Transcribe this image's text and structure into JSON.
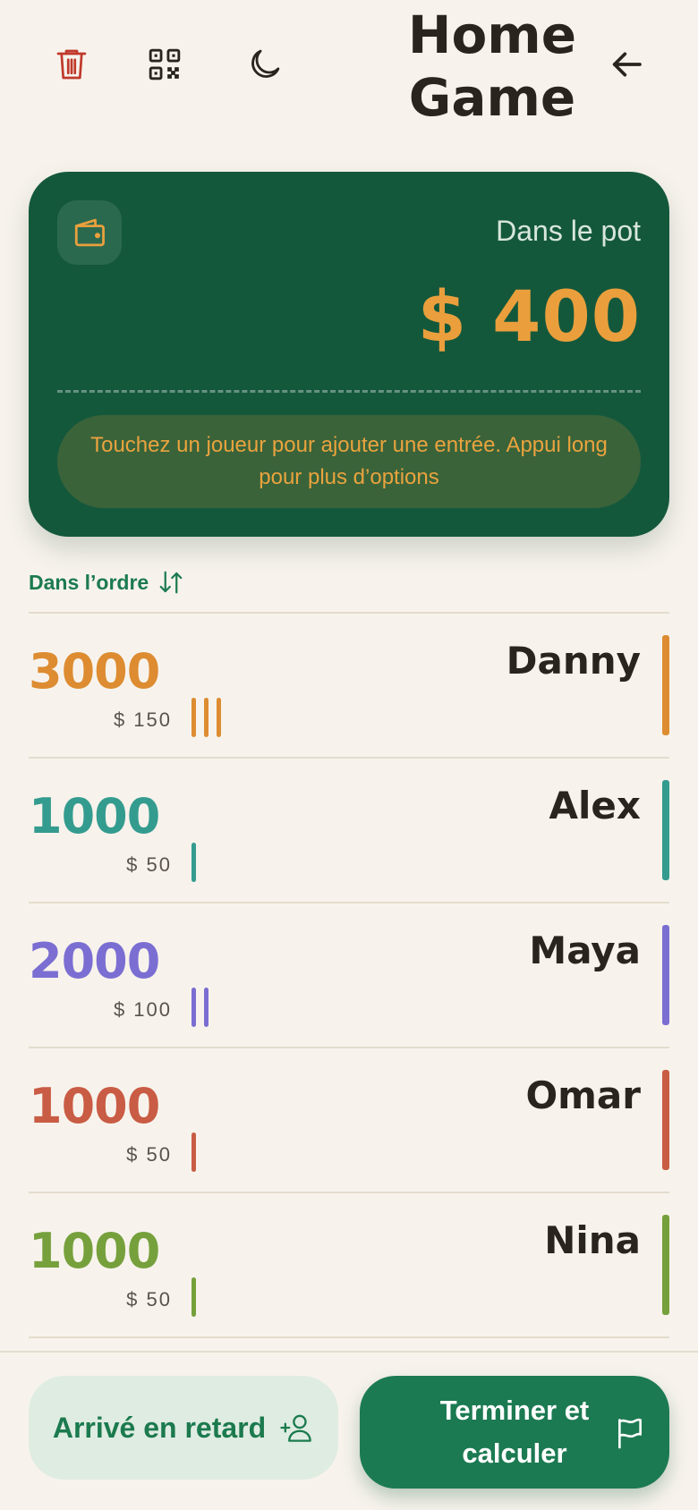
{
  "header": {
    "title": "Home Game",
    "icons": [
      "trash-icon",
      "qr-code-icon",
      "moon-icon",
      "arrow-left-icon"
    ]
  },
  "pot": {
    "label": "Dans le pot",
    "amount": "$ 400",
    "hint": "Touchez un joueur pour ajouter une entrée. Appui long pour plus d’options",
    "icon": "wallet-icon"
  },
  "sort": {
    "label": "Dans l’ordre",
    "icon": "sort-arrows-icon"
  },
  "players": [
    {
      "name": "Danny",
      "chips": "3000",
      "amount": "$ 150",
      "entries": 3,
      "color": "#dd8c31"
    },
    {
      "name": "Alex",
      "chips": "1000",
      "amount": "$ 50",
      "entries": 1,
      "color": "#349b8f"
    },
    {
      "name": "Maya",
      "chips": "2000",
      "amount": "$ 100",
      "entries": 2,
      "color": "#7b6ed2"
    },
    {
      "name": "Omar",
      "chips": "1000",
      "amount": "$ 50",
      "entries": 1,
      "color": "#c95c44"
    },
    {
      "name": "Nina",
      "chips": "1000",
      "amount": "$ 50",
      "entries": 1,
      "color": "#76a03c"
    }
  ],
  "actions": {
    "late_label": "Arrivé en retard",
    "finish_label": "Terminer et calculer"
  },
  "colors": {
    "background": "#f7f3ec",
    "pot_card": "#14583c",
    "accent_green": "#1c7a52",
    "pot_amount": "#ea9f3c"
  }
}
